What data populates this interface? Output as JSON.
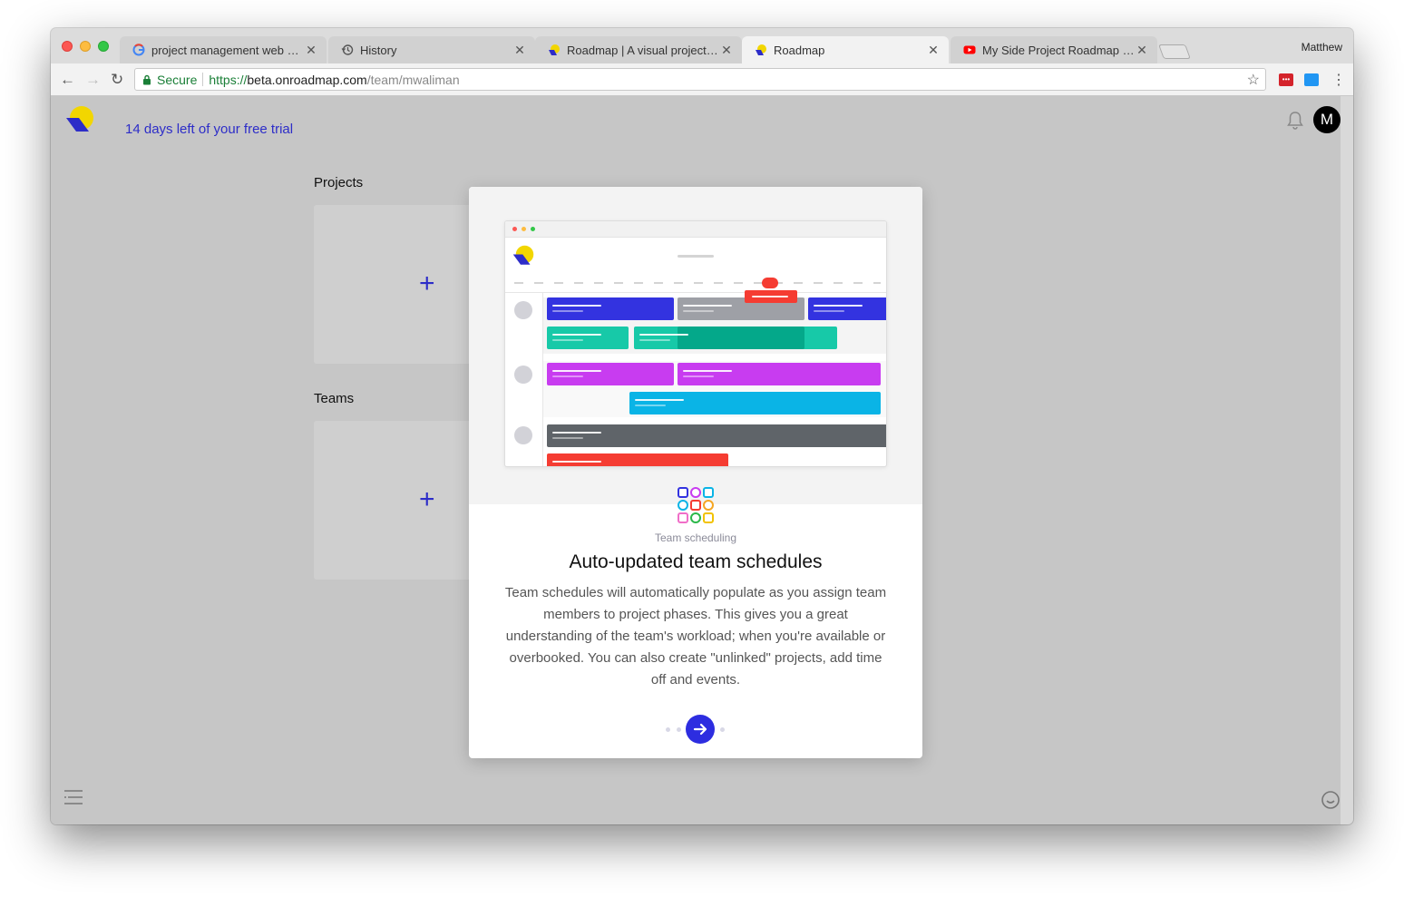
{
  "browser": {
    "profile_name": "Matthew",
    "tabs": [
      {
        "title": "project management web app",
        "favicon": "google-icon"
      },
      {
        "title": "History",
        "favicon": "history-icon"
      },
      {
        "title": "Roadmap | A visual project and",
        "favicon": "roadmap-icon"
      },
      {
        "title": "Roadmap",
        "favicon": "roadmap-icon",
        "active": true
      },
      {
        "title": "My Side Project Roadmap - Yo",
        "favicon": "youtube-icon"
      }
    ],
    "close_glyph": "✕",
    "security_label": "Secure",
    "url": {
      "scheme": "https://",
      "host": "beta.onroadmap.com",
      "path": "/team/mwaliman"
    }
  },
  "app": {
    "trial_text": "14 days left of your free trial",
    "avatar_initial": "M",
    "projects_label": "Projects",
    "teams_label": "Teams",
    "add_glyph": "+"
  },
  "modal": {
    "category": "Team scheduling",
    "title": "Auto-updated team schedules",
    "body": "Team schedules will automatically populate as you assign team members to project phases. This gives you a great understanding of the team's workload; when you're available or overbooked. You can also create \"unlinked\" projects, add time off and events.",
    "pager": {
      "total": 4,
      "current": 3
    }
  },
  "colors": {
    "accent": "#2d2dc8",
    "logo_yellow": "#f2d600",
    "logo_blue": "#2d2dc8",
    "bar_blue": "#3333e0",
    "bar_gray": "#9ea0a6",
    "bar_teal": "#17c9a8",
    "bar_teal_dark": "#04a88a",
    "bar_purple": "#c83cf0",
    "bar_cyan": "#0ab4e6",
    "bar_dark": "#5f6469",
    "bar_red": "#f53c32"
  }
}
